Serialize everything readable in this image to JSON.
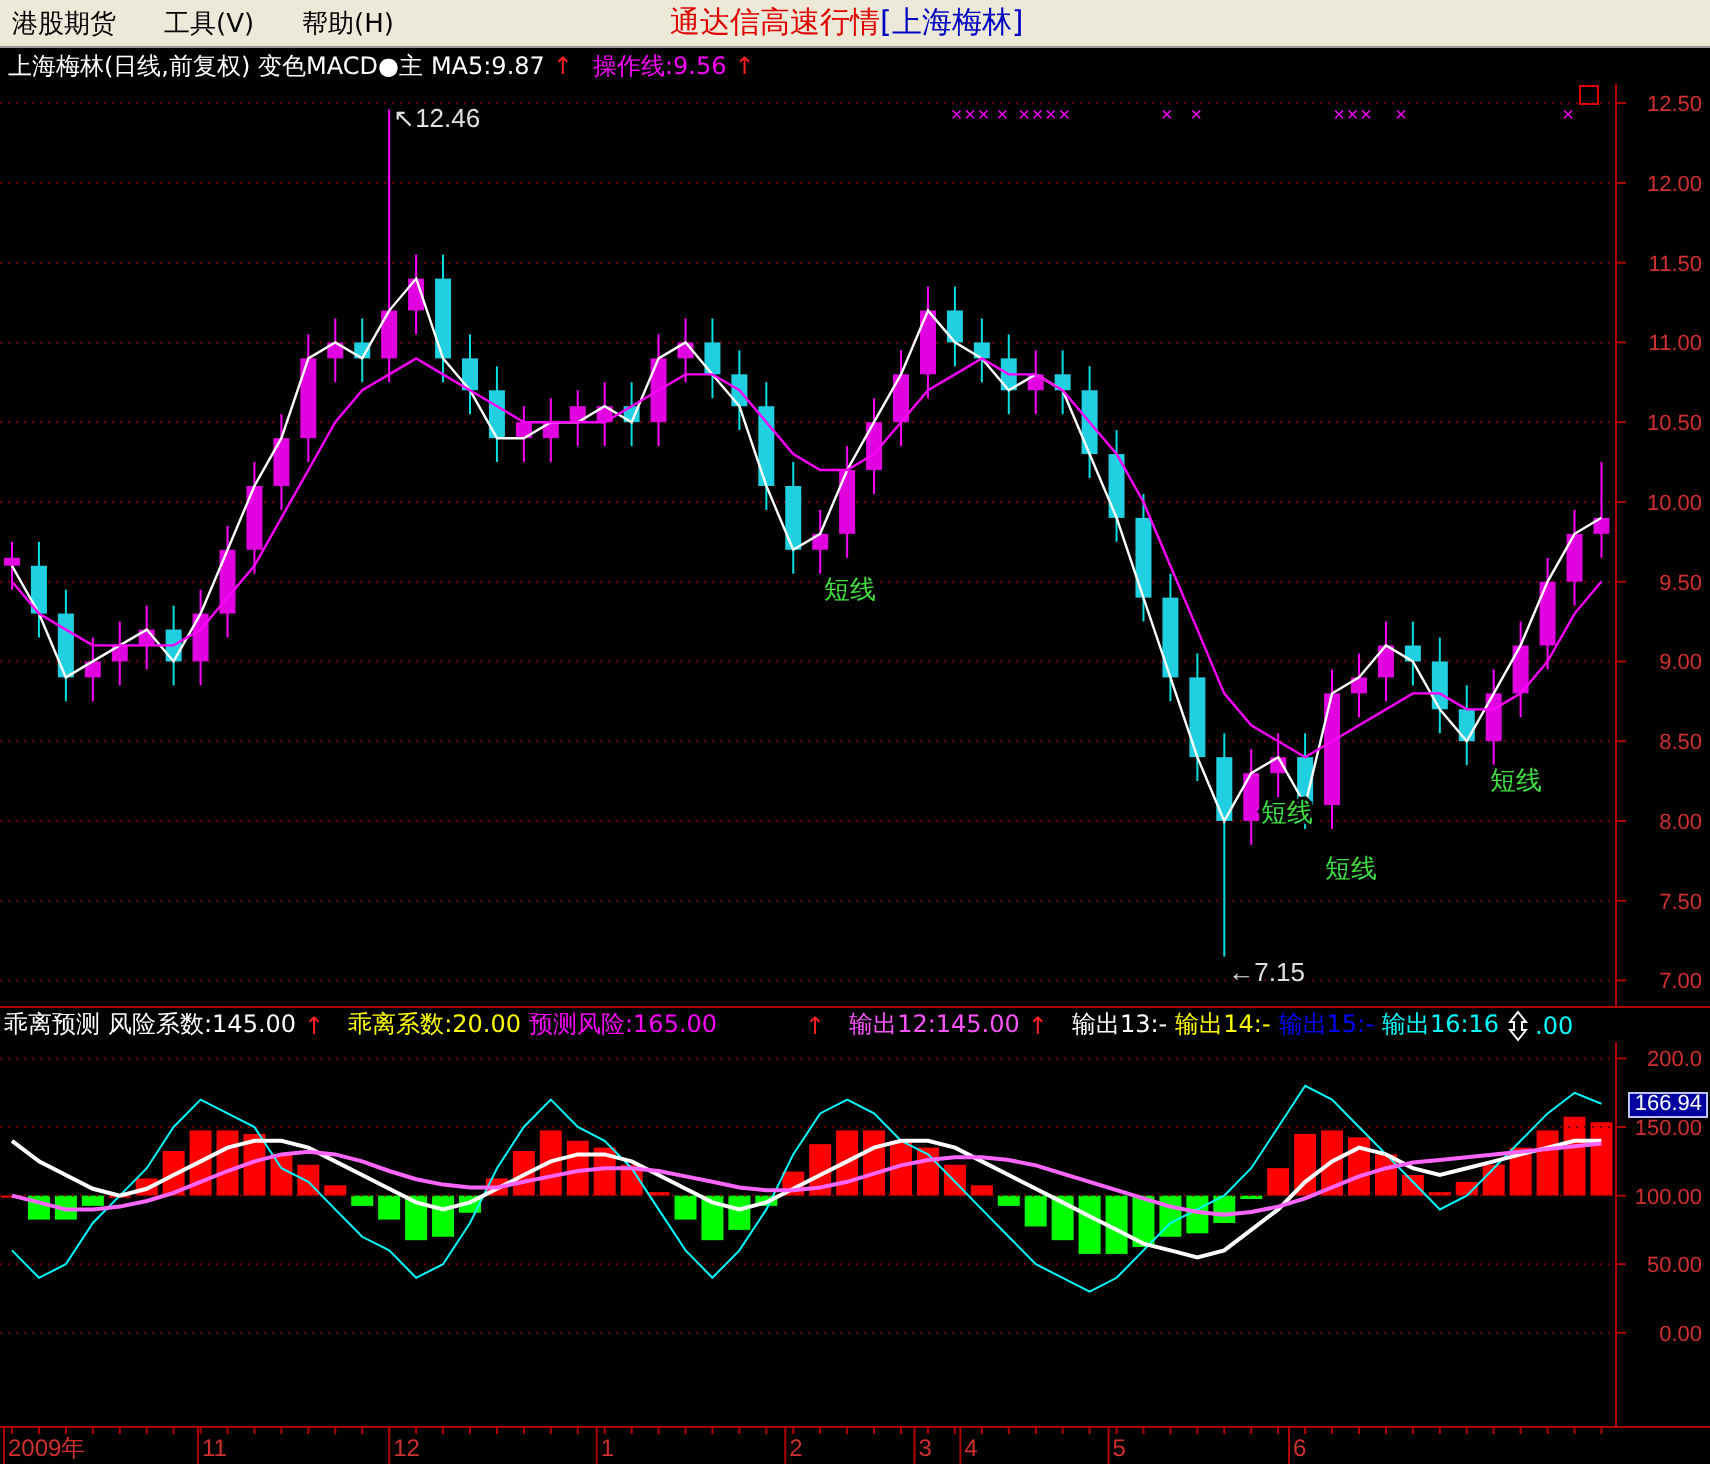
{
  "menu": [
    {
      "label": "港股期货"
    },
    {
      "label": "工具(V)"
    },
    {
      "label": "帮助(H)"
    }
  ],
  "title": {
    "app": "通达信高速行情",
    "stock": "[上海梅林]"
  },
  "price_panel": {
    "legend": [
      {
        "text": "上海梅林(日线,前复权) 变色MACD●主",
        "color": "#ffffff"
      },
      {
        "text": "MA5:9.87",
        "color": "#ffffff",
        "arrow": "↑"
      },
      {
        "text": "操作线:9.56",
        "color": "#ff00ff",
        "arrow": "↑"
      }
    ],
    "chart_data": {
      "type": "candlestick",
      "ylim": [
        6.84,
        12.62
      ],
      "grid": true,
      "yticks": [
        {
          "value": 12.5,
          "label": "12.50"
        },
        {
          "value": 12,
          "label": "12.00"
        },
        {
          "value": 11.5,
          "label": "11.50"
        },
        {
          "value": 11,
          "label": "11.00"
        },
        {
          "value": 10.5,
          "label": "10.50"
        },
        {
          "value": 10,
          "label": "10.00"
        },
        {
          "value": 9.5,
          "label": "9.50"
        },
        {
          "value": 9,
          "label": "9.00"
        },
        {
          "value": 8.5,
          "label": "8.50"
        },
        {
          "value": 8,
          "label": "8.00"
        },
        {
          "value": 7.5,
          "label": "7.50"
        },
        {
          "value": 7,
          "label": "7.00"
        }
      ],
      "ohlc": [
        [
          9.6,
          9.75,
          9.45,
          9.65
        ],
        [
          9.6,
          9.75,
          9.15,
          9.3
        ],
        [
          9.3,
          9.45,
          8.75,
          8.9
        ],
        [
          8.9,
          9.15,
          8.75,
          9.0
        ],
        [
          9.0,
          9.25,
          8.85,
          9.1
        ],
        [
          9.1,
          9.35,
          8.95,
          9.2
        ],
        [
          9.2,
          9.35,
          8.85,
          9.0
        ],
        [
          9.0,
          9.45,
          8.85,
          9.3
        ],
        [
          9.3,
          9.85,
          9.15,
          9.7
        ],
        [
          9.7,
          10.25,
          9.55,
          10.1
        ],
        [
          10.1,
          10.55,
          9.95,
          10.4
        ],
        [
          10.4,
          11.05,
          10.25,
          10.9
        ],
        [
          10.9,
          11.15,
          10.75,
          11.0
        ],
        [
          11.0,
          11.15,
          10.75,
          10.9
        ],
        [
          10.9,
          12.46,
          10.75,
          11.2
        ],
        [
          11.2,
          11.55,
          11.05,
          11.4
        ],
        [
          11.4,
          11.55,
          10.75,
          10.9
        ],
        [
          10.9,
          11.05,
          10.55,
          10.7
        ],
        [
          10.7,
          10.85,
          10.25,
          10.4
        ],
        [
          10.4,
          10.6,
          10.25,
          10.5
        ],
        [
          10.4,
          10.65,
          10.25,
          10.5
        ],
        [
          10.5,
          10.7,
          10.35,
          10.6
        ],
        [
          10.5,
          10.75,
          10.35,
          10.6
        ],
        [
          10.6,
          10.75,
          10.35,
          10.5
        ],
        [
          10.5,
          11.05,
          10.35,
          10.9
        ],
        [
          10.9,
          11.15,
          10.75,
          11.0
        ],
        [
          11.0,
          11.15,
          10.65,
          10.8
        ],
        [
          10.8,
          10.95,
          10.45,
          10.6
        ],
        [
          10.6,
          10.75,
          9.95,
          10.1
        ],
        [
          10.1,
          10.25,
          9.55,
          9.7
        ],
        [
          9.7,
          9.95,
          9.55,
          9.8
        ],
        [
          9.8,
          10.35,
          9.65,
          10.2
        ],
        [
          10.2,
          10.65,
          10.05,
          10.5
        ],
        [
          10.5,
          10.95,
          10.35,
          10.8
        ],
        [
          10.8,
          11.35,
          10.65,
          11.2
        ],
        [
          11.2,
          11.35,
          10.85,
          11.0
        ],
        [
          11.0,
          11.15,
          10.75,
          10.9
        ],
        [
          10.9,
          11.05,
          10.55,
          10.7
        ],
        [
          10.7,
          10.95,
          10.55,
          10.8
        ],
        [
          10.8,
          10.95,
          10.55,
          10.7
        ],
        [
          10.7,
          10.85,
          10.15,
          10.3
        ],
        [
          10.3,
          10.45,
          9.75,
          9.9
        ],
        [
          9.9,
          10.05,
          9.25,
          9.4
        ],
        [
          9.4,
          9.55,
          8.75,
          8.9
        ],
        [
          8.9,
          9.05,
          8.25,
          8.4
        ],
        [
          8.4,
          8.55,
          7.15,
          8.0
        ],
        [
          8.0,
          8.45,
          7.85,
          8.3
        ],
        [
          8.3,
          8.55,
          8.15,
          8.4
        ],
        [
          8.4,
          8.55,
          7.95,
          8.1
        ],
        [
          8.1,
          8.95,
          7.95,
          8.8
        ],
        [
          8.8,
          9.05,
          8.65,
          8.9
        ],
        [
          8.9,
          9.25,
          8.75,
          9.1
        ],
        [
          9.1,
          9.25,
          8.85,
          9.0
        ],
        [
          9.0,
          9.15,
          8.55,
          8.7
        ],
        [
          8.7,
          8.85,
          8.35,
          8.5
        ],
        [
          8.5,
          8.95,
          8.35,
          8.8
        ],
        [
          8.8,
          9.25,
          8.65,
          9.1
        ],
        [
          9.1,
          9.65,
          8.95,
          9.5
        ],
        [
          9.5,
          9.95,
          9.35,
          9.8
        ],
        [
          9.8,
          10.25,
          9.65,
          9.9
        ]
      ],
      "series": [
        {
          "type": "line",
          "color": "#ffffff",
          "values": [
            9.6,
            9.3,
            8.9,
            9.0,
            9.1,
            9.2,
            9.0,
            9.3,
            9.7,
            10.1,
            10.4,
            10.9,
            11.0,
            10.9,
            11.2,
            11.4,
            10.9,
            10.7,
            10.4,
            10.4,
            10.5,
            10.5,
            10.6,
            10.5,
            10.9,
            11.0,
            10.8,
            10.6,
            10.1,
            9.7,
            9.8,
            10.2,
            10.5,
            10.8,
            11.2,
            11.0,
            10.9,
            10.7,
            10.8,
            10.7,
            10.3,
            9.9,
            9.4,
            8.9,
            8.4,
            8.0,
            8.3,
            8.4,
            8.1,
            8.8,
            8.9,
            9.1,
            9.0,
            8.7,
            8.5,
            8.8,
            9.1,
            9.5,
            9.8,
            9.9
          ]
        },
        {
          "type": "line",
          "color": "#ff00ff",
          "values": [
            9.5,
            9.3,
            9.2,
            9.1,
            9.1,
            9.1,
            9.1,
            9.2,
            9.4,
            9.6,
            9.9,
            10.2,
            10.5,
            10.7,
            10.8,
            10.9,
            10.8,
            10.7,
            10.6,
            10.5,
            10.5,
            10.5,
            10.5,
            10.6,
            10.7,
            10.8,
            10.8,
            10.7,
            10.5,
            10.3,
            10.2,
            10.2,
            10.3,
            10.5,
            10.7,
            10.8,
            10.9,
            10.8,
            10.8,
            10.7,
            10.5,
            10.3,
            10.0,
            9.6,
            9.2,
            8.8,
            8.6,
            8.5,
            8.4,
            8.5,
            8.6,
            8.7,
            8.8,
            8.8,
            8.7,
            8.7,
            8.8,
            9.0,
            9.3,
            9.5
          ]
        }
      ],
      "annotations": [
        "↖12.46",
        "←7.15",
        "短线",
        "短线",
        "短线",
        "短线",
        "×",
        "×",
        "×",
        "×",
        "×",
        "×",
        "×",
        "×",
        "×",
        "×",
        "×",
        "×",
        "×",
        "×",
        "×"
      ]
    }
  },
  "indicator_panel": {
    "legend": [
      {
        "text": "乖离预测",
        "color": "#ffffff"
      },
      {
        "text": "风险系数:145.00",
        "color": "#ffffff",
        "arrow": "↑"
      },
      {
        "text": "乖离系数:20.00",
        "color": "#ffff00"
      },
      {
        "text": "预测风险:165.00",
        "color": "#ff00ff",
        "arrow": "↑"
      },
      {
        "text": "输出12:145.00",
        "color": "#ff55ff",
        "arrow": "↑"
      },
      {
        "text": "输出13:-",
        "color": "#ffffff"
      },
      {
        "text": "输出14:-",
        "color": "#ffff00"
      },
      {
        "text": "输出15:-",
        "color": "#0000ff"
      },
      {
        "text": "输出16:16",
        "color": "#00ffff"
      },
      {
        "text": ".00",
        "color": "#00ffff"
      }
    ],
    "current_value": "166.94",
    "chart_data": {
      "type": "line",
      "ylim": [
        -68,
        212
      ],
      "grid": true,
      "yticks": [
        {
          "value": 200,
          "label": "200.0"
        },
        {
          "value": 150,
          "label": "150.00"
        },
        {
          "value": 100,
          "label": "100.00"
        },
        {
          "value": 50,
          "label": "50.00"
        },
        {
          "value": 0,
          "label": "0.00"
        }
      ],
      "series": [
        {
          "color": "#00ffff",
          "values": [
            60,
            40,
            50,
            80,
            100,
            120,
            150,
            170,
            160,
            150,
            120,
            110,
            90,
            70,
            60,
            40,
            50,
            80,
            120,
            150,
            170,
            150,
            140,
            120,
            90,
            60,
            40,
            60,
            90,
            130,
            160,
            170,
            160,
            140,
            130,
            110,
            90,
            70,
            50,
            40,
            30,
            40,
            60,
            80,
            90,
            100,
            120,
            150,
            180,
            170,
            150,
            130,
            110,
            90,
            100,
            120,
            140,
            160,
            175,
            167
          ]
        },
        {
          "color": "#ffffff",
          "values": [
            140,
            125,
            115,
            105,
            100,
            105,
            115,
            125,
            135,
            140,
            140,
            135,
            125,
            115,
            105,
            95,
            90,
            95,
            105,
            115,
            125,
            130,
            130,
            125,
            115,
            105,
            95,
            90,
            95,
            105,
            115,
            125,
            135,
            140,
            140,
            135,
            125,
            115,
            105,
            95,
            85,
            75,
            65,
            60,
            55,
            60,
            75,
            90,
            110,
            125,
            135,
            130,
            120,
            115,
            120,
            125,
            130,
            135,
            140,
            140
          ]
        },
        {
          "color": "#ff66ff",
          "values": [
            100,
            95,
            90,
            90,
            92,
            96,
            102,
            110,
            118,
            125,
            130,
            132,
            130,
            125,
            118,
            112,
            108,
            106,
            106,
            110,
            114,
            118,
            120,
            120,
            118,
            114,
            110,
            106,
            104,
            104,
            106,
            110,
            116,
            122,
            126,
            128,
            128,
            126,
            122,
            116,
            110,
            104,
            98,
            92,
            88,
            86,
            88,
            92,
            98,
            106,
            114,
            120,
            124,
            126,
            128,
            130,
            132,
            134,
            136,
            138
          ]
        }
      ]
    }
  },
  "time_axis": {
    "labels": [
      "2009年",
      "11",
      "12",
      "1",
      "2",
      "3",
      "4",
      "5",
      "6"
    ]
  }
}
